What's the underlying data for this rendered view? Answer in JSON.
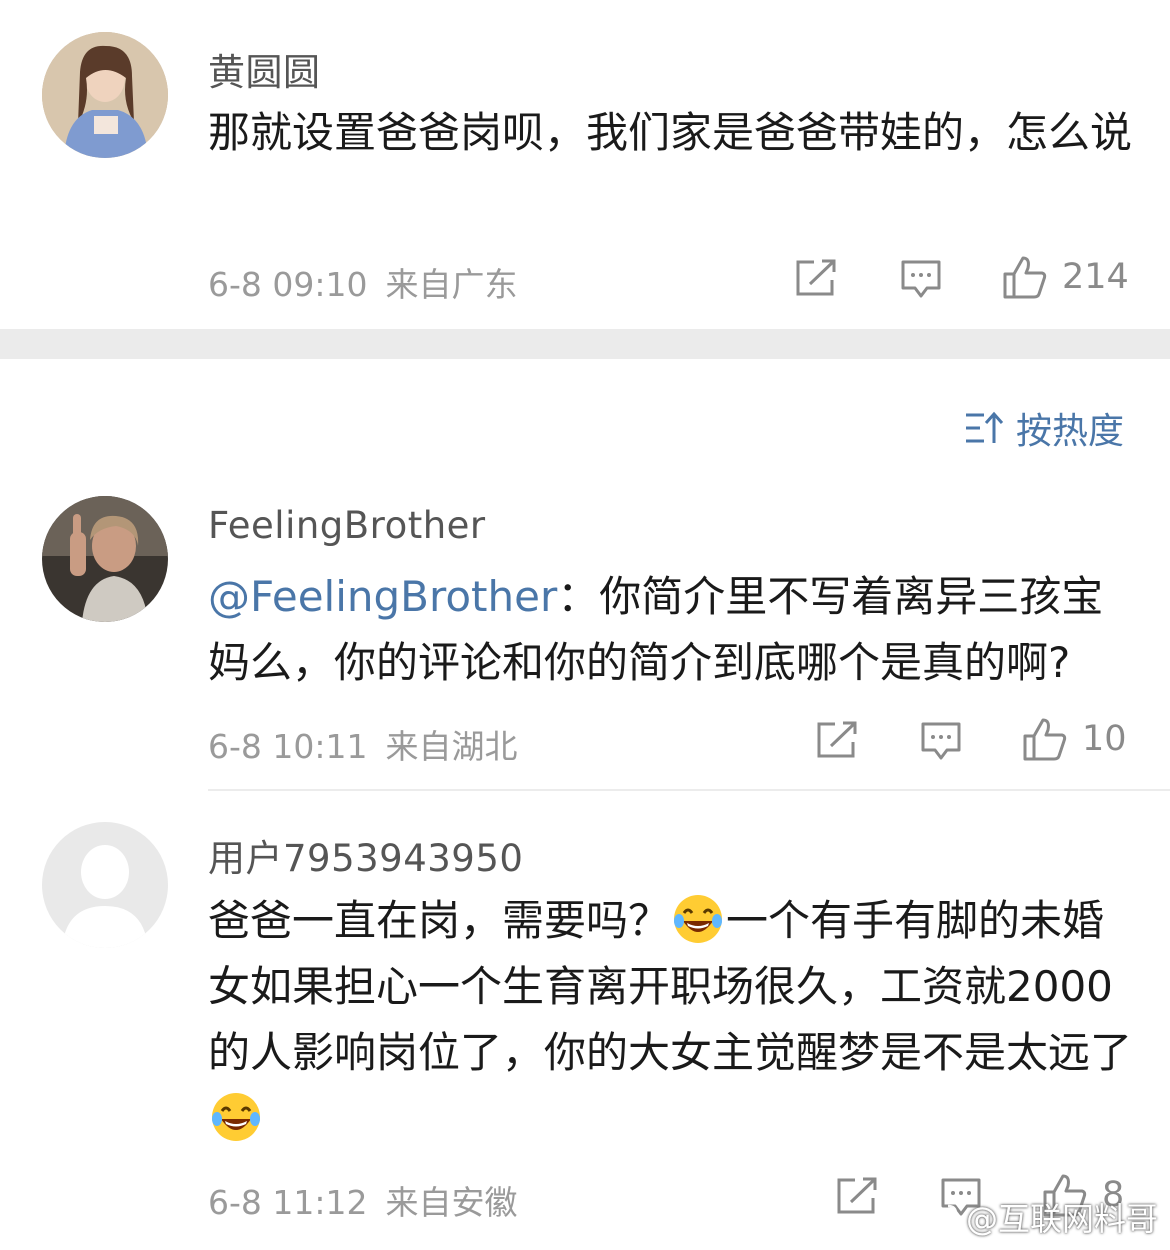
{
  "comments": [
    {
      "username": "黄圆圆",
      "text": "那就设置爸爸岗呗，我们家是爸爸带娃的，怎么说",
      "date": "6-8 09:10",
      "location": "来自广东",
      "likes": "214"
    },
    {
      "username": "FeelingBrother",
      "mention": "@FeelingBrother",
      "text": "：你简介里不写着离异三孩宝妈么，你的评论和你的简介到底哪个是真的啊?",
      "date": "6-8 10:11",
      "location": "来自湖北",
      "likes": "10"
    },
    {
      "username": "用户7953943950",
      "text_a": "爸爸一直在岗，需要吗？",
      "text_b": "一个有手有脚的未婚女如果担心一个生育离开职场很久，工资就2000的人影响岗位了，你的大女主觉醒梦是不是太远了",
      "date": "6-8 11:12",
      "location": "来自安徽",
      "likes": "8"
    }
  ],
  "sort": {
    "label": "按热度"
  },
  "watermark": "@互联网料哥",
  "icons": [
    "share-icon",
    "comment-icon",
    "like-icon",
    "sort-icon",
    "laugh-cry-emoji",
    "weibo-logo"
  ],
  "colors": {
    "link": "#4a76a8",
    "meta": "#9a9a9a",
    "separator": "#ebebeb"
  }
}
